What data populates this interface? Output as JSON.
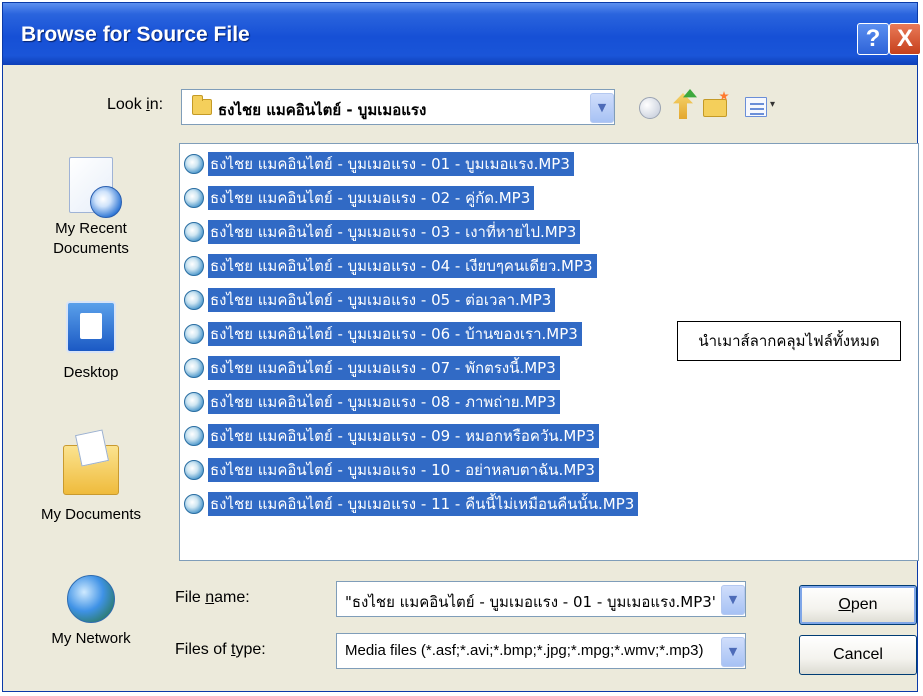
{
  "window": {
    "title": "Browse for Source File",
    "help_label": "?",
    "close_label": "X"
  },
  "look_in": {
    "label_prefix": "Look ",
    "label_access_key": "i",
    "label_suffix": "n:",
    "value": "ธงไชย แมคอินไตย์ - บูมเมอแรง"
  },
  "toolbar": {
    "icons": [
      "back-icon",
      "up-one-level-icon",
      "create-new-folder-icon",
      "views-menu-icon"
    ],
    "dropdown_glyph": "▼",
    "views_arrow_glyph": "▾"
  },
  "places_bar": [
    {
      "label_lines": [
        "My Recent",
        "Documents"
      ],
      "icon": "recent-documents-icon"
    },
    {
      "label_lines": [
        "Desktop"
      ],
      "icon": "desktop-icon"
    },
    {
      "label_lines": [
        "My Documents"
      ],
      "icon": "my-documents-icon"
    },
    {
      "label_lines": [
        "My Network"
      ],
      "icon": "my-network-icon"
    }
  ],
  "files": [
    "ธงไชย แมคอินไตย์ - บูมเมอแรง - 01 - บูมเมอแรง.MP3",
    "ธงไชย แมคอินไตย์ - บูมเมอแรง - 02 - คู่กัด.MP3",
    "ธงไชย แมคอินไตย์ - บูมเมอแรง - 03 - เงาที่หายไป.MP3",
    "ธงไชย แมคอินไตย์ - บูมเมอแรง - 04 - เงียบๆคนเดียว.MP3",
    "ธงไชย แมคอินไตย์ - บูมเมอแรง - 05 - ต่อเวลา.MP3",
    "ธงไชย แมคอินไตย์ - บูมเมอแรง - 06 - บ้านของเรา.MP3",
    "ธงไชย แมคอินไตย์ - บูมเมอแรง - 07 - พักตรงนี้.MP3",
    "ธงไชย แมคอินไตย์ - บูมเมอแรง - 08 - ภาพถ่าย.MP3",
    "ธงไชย แมคอินไตย์ - บูมเมอแรง - 09 - หมอกหรือควัน.MP3",
    "ธงไชย แมคอินไตย์ - บูมเมอแรง - 10 - อย่าหลบตาฉัน.MP3",
    "ธงไชย แมคอินไตย์ - บูมเมอแรง - 11 - คืนนี้ไม่เหมือนคืนนั้น.MP3"
  ],
  "callout": "นำเมาส์ลากคลุมไฟล์ทั้งหมด",
  "file_name": {
    "label_prefix": "File ",
    "label_access_key": "n",
    "label_suffix": "ame:",
    "value": "\"ธงไชย แมคอินไตย์ - บูมเมอแรง - 01 - บูมเมอแรง.MP3\""
  },
  "file_type": {
    "label_prefix": "Files of ",
    "label_access_key": "t",
    "label_suffix": "ype:",
    "value": "Media files (*.asf;*.avi;*.bmp;*.jpg;*.mpg;*.wmv;*.mp3)"
  },
  "buttons": {
    "open_access_key": "O",
    "open_rest": "pen",
    "cancel": "Cancel"
  },
  "colors": {
    "titlebar": "#1650d6",
    "selection": "#316ac5",
    "dialog_bg": "#eceadb"
  }
}
